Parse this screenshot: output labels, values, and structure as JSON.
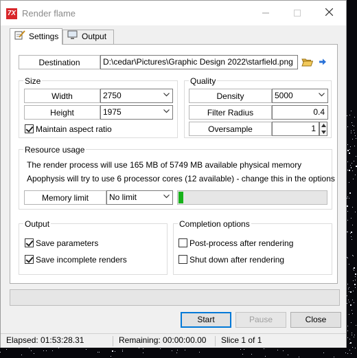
{
  "window": {
    "title": "Render flame",
    "app_icon_text": "7X"
  },
  "tabs": [
    {
      "label": "Settings",
      "icon": "pencil-pad-icon",
      "active": true
    },
    {
      "label": "Output",
      "icon": "monitor-icon",
      "active": false
    }
  ],
  "destination": {
    "label": "Destination",
    "value": "D:\\cedar\\Pictures\\Graphic Design 2022\\starfield.png"
  },
  "size": {
    "group_label": "Size",
    "width_label": "Width",
    "width_value": "2750",
    "height_label": "Height",
    "height_value": "1975",
    "maintain_aspect_label": "Maintain aspect ratio",
    "maintain_aspect_checked": true
  },
  "quality": {
    "group_label": "Quality",
    "density_label": "Density",
    "density_value": "5000",
    "filter_radius_label": "Filter Radius",
    "filter_radius_value": "0.4",
    "oversample_label": "Oversample",
    "oversample_value": "1"
  },
  "resource": {
    "group_label": "Resource usage",
    "memory_text": "The render process will use 165 MB of 5749 MB available physical memory",
    "cores_text": "Apophysis will try to use 6 processor cores (12 available) - change this in the options",
    "memory_limit_label": "Memory limit",
    "memory_limit_value": "No limit",
    "memory_bar_fraction": 0.03
  },
  "output": {
    "group_label": "Output",
    "save_parameters_label": "Save parameters",
    "save_parameters_checked": true,
    "save_incomplete_label": "Save incomplete renders",
    "save_incomplete_checked": true
  },
  "completion": {
    "group_label": "Completion options",
    "post_process_label": "Post-process after rendering",
    "post_process_checked": false,
    "shutdown_label": "Shut down after rendering",
    "shutdown_checked": false
  },
  "progress": {
    "value": 0
  },
  "buttons": {
    "start": "Start",
    "pause": "Pause",
    "close": "Close"
  },
  "status": {
    "elapsed": "Elapsed: 01:53:28.31",
    "remaining": "Remaining: 00:00:00.00",
    "slice": "Slice 1 of 1"
  },
  "colors": {
    "accent": "#0078d7",
    "memory_bar": "#17b21a",
    "app_icon": "#d8262a"
  }
}
